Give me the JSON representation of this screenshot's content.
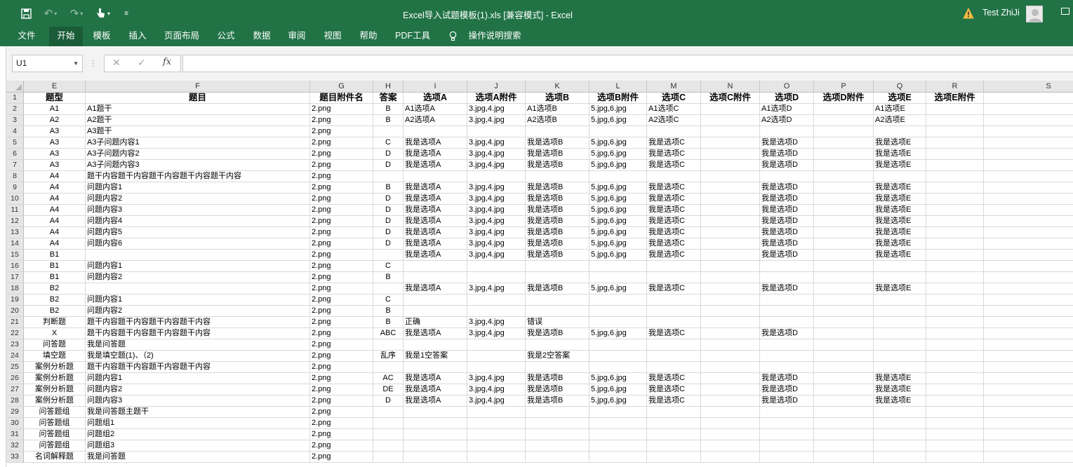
{
  "titlebar": {
    "title": "Excel导入试题模板(1).xls  [兼容模式]  -  Excel",
    "user": "Test ZhiJi",
    "icons": [
      "save-icon",
      "undo-icon",
      "redo-icon",
      "touch-mode-icon",
      "customize-qat-icon",
      "warning-icon",
      "avatar",
      "ribbon-display-icon"
    ],
    "accent": "#217346"
  },
  "ribbon": {
    "tabs": [
      "文件",
      "开始",
      "模板",
      "插入",
      "页面布局",
      "公式",
      "数据",
      "审阅",
      "视图",
      "帮助",
      "PDF工具"
    ],
    "active_tab": "开始",
    "tell_me": "操作说明搜索"
  },
  "formula_bar": {
    "name_box": "U1",
    "cancel": "✕",
    "enter": "✓",
    "fx": "fx",
    "formula": ""
  },
  "sheet": {
    "columns": [
      "E",
      "F",
      "G",
      "H",
      "I",
      "J",
      "K",
      "L",
      "M",
      "N",
      "O",
      "P",
      "Q",
      "R",
      "S"
    ],
    "rows": [
      [
        "题型",
        "题目",
        "题目附件名",
        "答案",
        "选项A",
        "选项A附件",
        "选项B",
        "选项B附件",
        "选项C",
        "选项C附件",
        "选项D",
        "选项D附件",
        "选项E",
        "选项E附件",
        ""
      ],
      [
        "A1",
        "A1题干",
        "2.png",
        "B",
        "A1选项A",
        "3.jpg,4.jpg",
        "A1选项B",
        "5.jpg,6.jpg",
        "A1选项C",
        "",
        "A1选项D",
        "",
        "A1选项E",
        "",
        ""
      ],
      [
        "A2",
        "A2题干",
        "2.png",
        "B",
        "A2选项A",
        "3.jpg,4.jpg",
        "A2选项B",
        "5.jpg,6.jpg",
        "A2选项C",
        "",
        "A2选项D",
        "",
        "A2选项E",
        "",
        ""
      ],
      [
        "A3",
        "A3题干",
        "2.png",
        "",
        "",
        "",
        "",
        "",
        "",
        "",
        "",
        "",
        "",
        "",
        ""
      ],
      [
        "A3",
        "A3子问题内容1",
        "2.png",
        "C",
        "我是选项A",
        "3.jpg,4.jpg",
        "我是选项B",
        "5.jpg,6.jpg",
        "我是选项C",
        "",
        "我是选项D",
        "",
        "我是选项E",
        "",
        ""
      ],
      [
        "A3",
        "A3子问题内容2",
        "2.png",
        "D",
        "我是选项A",
        "3.jpg,4.jpg",
        "我是选项B",
        "5.jpg,6.jpg",
        "我是选项C",
        "",
        "我是选项D",
        "",
        "我是选项E",
        "",
        ""
      ],
      [
        "A3",
        "A3子问题内容3",
        "2.png",
        "D",
        "我是选项A",
        "3.jpg,4.jpg",
        "我是选项B",
        "5.jpg,6.jpg",
        "我是选项C",
        "",
        "我是选项D",
        "",
        "我是选项E",
        "",
        ""
      ],
      [
        "A4",
        "题干内容题干内容题干内容题干内容题干内容",
        "2.png",
        "",
        "",
        "",
        "",
        "",
        "",
        "",
        "",
        "",
        "",
        "",
        ""
      ],
      [
        "A4",
        "问题内容1",
        "2.png",
        "B",
        "我是选项A",
        "3.jpg,4.jpg",
        "我是选项B",
        "5.jpg,6.jpg",
        "我是选项C",
        "",
        "我是选项D",
        "",
        "我是选项E",
        "",
        ""
      ],
      [
        "A4",
        "问题内容2",
        "2.png",
        "D",
        "我是选项A",
        "3.jpg,4.jpg",
        "我是选项B",
        "5.jpg,6.jpg",
        "我是选项C",
        "",
        "我是选项D",
        "",
        "我是选项E",
        "",
        ""
      ],
      [
        "A4",
        "问题内容3",
        "2.png",
        "D",
        "我是选项A",
        "3.jpg,4.jpg",
        "我是选项B",
        "5.jpg,6.jpg",
        "我是选项C",
        "",
        "我是选项D",
        "",
        "我是选项E",
        "",
        ""
      ],
      [
        "A4",
        "问题内容4",
        "2.png",
        "D",
        "我是选项A",
        "3.jpg,4.jpg",
        "我是选项B",
        "5.jpg,6.jpg",
        "我是选项C",
        "",
        "我是选项D",
        "",
        "我是选项E",
        "",
        ""
      ],
      [
        "A4",
        "问题内容5",
        "2.png",
        "D",
        "我是选项A",
        "3.jpg,4.jpg",
        "我是选项B",
        "5.jpg,6.jpg",
        "我是选项C",
        "",
        "我是选项D",
        "",
        "我是选项E",
        "",
        ""
      ],
      [
        "A4",
        "问题内容6",
        "2.png",
        "D",
        "我是选项A",
        "3.jpg,4.jpg",
        "我是选项B",
        "5.jpg,6.jpg",
        "我是选项C",
        "",
        "我是选项D",
        "",
        "我是选项E",
        "",
        ""
      ],
      [
        "B1",
        "",
        "2.png",
        "",
        "我是选项A",
        "3.jpg,4.jpg",
        "我是选项B",
        "5.jpg,6.jpg",
        "我是选项C",
        "",
        "我是选项D",
        "",
        "我是选项E",
        "",
        ""
      ],
      [
        "B1",
        "问题内容1",
        "2.png",
        "C",
        "",
        "",
        "",
        "",
        "",
        "",
        "",
        "",
        "",
        "",
        ""
      ],
      [
        "B1",
        "问题内容2",
        "2.png",
        "B",
        "",
        "",
        "",
        "",
        "",
        "",
        "",
        "",
        "",
        "",
        ""
      ],
      [
        "B2",
        "",
        "2.png",
        "",
        "我是选项A",
        "3.jpg,4.jpg",
        "我是选项B",
        "5.jpg,6.jpg",
        "我是选项C",
        "",
        "我是选项D",
        "",
        "我是选项E",
        "",
        ""
      ],
      [
        "B2",
        "问题内容1",
        "2.png",
        "C",
        "",
        "",
        "",
        "",
        "",
        "",
        "",
        "",
        "",
        "",
        ""
      ],
      [
        "B2",
        "问题内容2",
        "2.png",
        "B",
        "",
        "",
        "",
        "",
        "",
        "",
        "",
        "",
        "",
        "",
        ""
      ],
      [
        "判断题",
        "题干内容题干内容题干内容题干内容",
        "2.png",
        "B",
        "正确",
        "3.jpg,4.jpg",
        "错误",
        "",
        "",
        "",
        "",
        "",
        "",
        "",
        ""
      ],
      [
        "X",
        "题干内容题干内容题干内容题干内容",
        "2.png",
        "ABC",
        "我是选项A",
        "3.jpg,4.jpg",
        "我是选项B",
        "5.jpg,6.jpg",
        "我是选项C",
        "",
        "我是选项D",
        "",
        "",
        "",
        ""
      ],
      [
        "问答题",
        "我是问答题",
        "2.png",
        "",
        "",
        "",
        "",
        "",
        "",
        "",
        "",
        "",
        "",
        "",
        ""
      ],
      [
        "填空题",
        "我是填空题(1)、（2)",
        "2.png",
        "乱序",
        "我是1空答案",
        "",
        "我是2空答案",
        "",
        "",
        "",
        "",
        "",
        "",
        "",
        ""
      ],
      [
        "案例分析题",
        "题干内容题干内容题干内容题干内容",
        "2.png",
        "",
        "",
        "",
        "",
        "",
        "",
        "",
        "",
        "",
        "",
        "",
        ""
      ],
      [
        "案例分析题",
        "问题内容1",
        "2.png",
        "AC",
        "我是选项A",
        "3.jpg,4.jpg",
        "我是选项B",
        "5.jpg,6.jpg",
        "我是选项C",
        "",
        "我是选项D",
        "",
        "我是选项E",
        "",
        ""
      ],
      [
        "案例分析题",
        "问题内容2",
        "2.png",
        "DE",
        "我是选项A",
        "3.jpg,4.jpg",
        "我是选项B",
        "5.jpg,6.jpg",
        "我是选项C",
        "",
        "我是选项D",
        "",
        "我是选项E",
        "",
        ""
      ],
      [
        "案例分析题",
        "问题内容3",
        "2.png",
        "D",
        "我是选项A",
        "3.jpg,4.jpg",
        "我是选项B",
        "5.jpg,6.jpg",
        "我是选项C",
        "",
        "我是选项D",
        "",
        "我是选项E",
        "",
        ""
      ],
      [
        "问答题组",
        "我是问答题主题干",
        "2.png",
        "",
        "",
        "",
        "",
        "",
        "",
        "",
        "",
        "",
        "",
        "",
        ""
      ],
      [
        "问答题组",
        "问题组1",
        "2.png",
        "",
        "",
        "",
        "",
        "",
        "",
        "",
        "",
        "",
        "",
        "",
        ""
      ],
      [
        "问答题组",
        "问题组2",
        "2.png",
        "",
        "",
        "",
        "",
        "",
        "",
        "",
        "",
        "",
        "",
        "",
        ""
      ],
      [
        "问答题组",
        "问题组3",
        "2.png",
        "",
        "",
        "",
        "",
        "",
        "",
        "",
        "",
        "",
        "",
        "",
        ""
      ],
      [
        "名词解释题",
        "我是问答题",
        "2.png",
        "",
        "",
        "",
        "",
        "",
        "",
        "",
        "",
        "",
        "",
        "",
        ""
      ]
    ]
  }
}
